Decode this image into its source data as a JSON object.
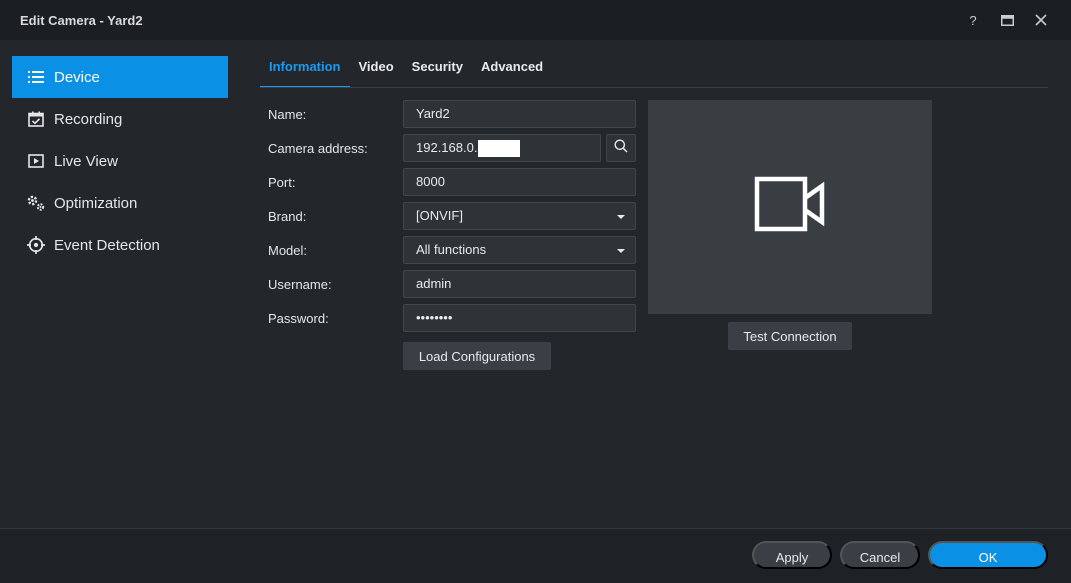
{
  "window": {
    "title": "Edit Camera - Yard2"
  },
  "titlebar": {
    "help": "?",
    "maximize": "▣",
    "close": "✕"
  },
  "sidebar": {
    "items": [
      {
        "label": "Device",
        "icon": "list-icon",
        "active": true
      },
      {
        "label": "Recording",
        "icon": "calendar-check-icon"
      },
      {
        "label": "Live View",
        "icon": "play-square-icon"
      },
      {
        "label": "Optimization",
        "icon": "gears-icon"
      },
      {
        "label": "Event Detection",
        "icon": "crosshair-icon"
      }
    ]
  },
  "tabs": [
    {
      "label": "Information",
      "active": true
    },
    {
      "label": "Video"
    },
    {
      "label": "Security"
    },
    {
      "label": "Advanced"
    }
  ],
  "form": {
    "name_label": "Name:",
    "name_value": "Yard2",
    "address_label": "Camera address:",
    "address_value": "192.168.0.",
    "port_label": "Port:",
    "port_value": "8000",
    "brand_label": "Brand:",
    "brand_value": "[ONVIF]",
    "model_label": "Model:",
    "model_value": "All functions",
    "username_label": "Username:",
    "username_value": "admin",
    "password_label": "Password:",
    "password_value": "••••••••",
    "load_button": "Load Configurations"
  },
  "preview": {
    "test_button": "Test Connection",
    "icon": "video-camera-icon"
  },
  "footer": {
    "apply": "Apply",
    "cancel": "Cancel",
    "ok": "OK"
  },
  "colors": {
    "accent": "#0a91e6",
    "active_tab": "#1a9bef"
  }
}
